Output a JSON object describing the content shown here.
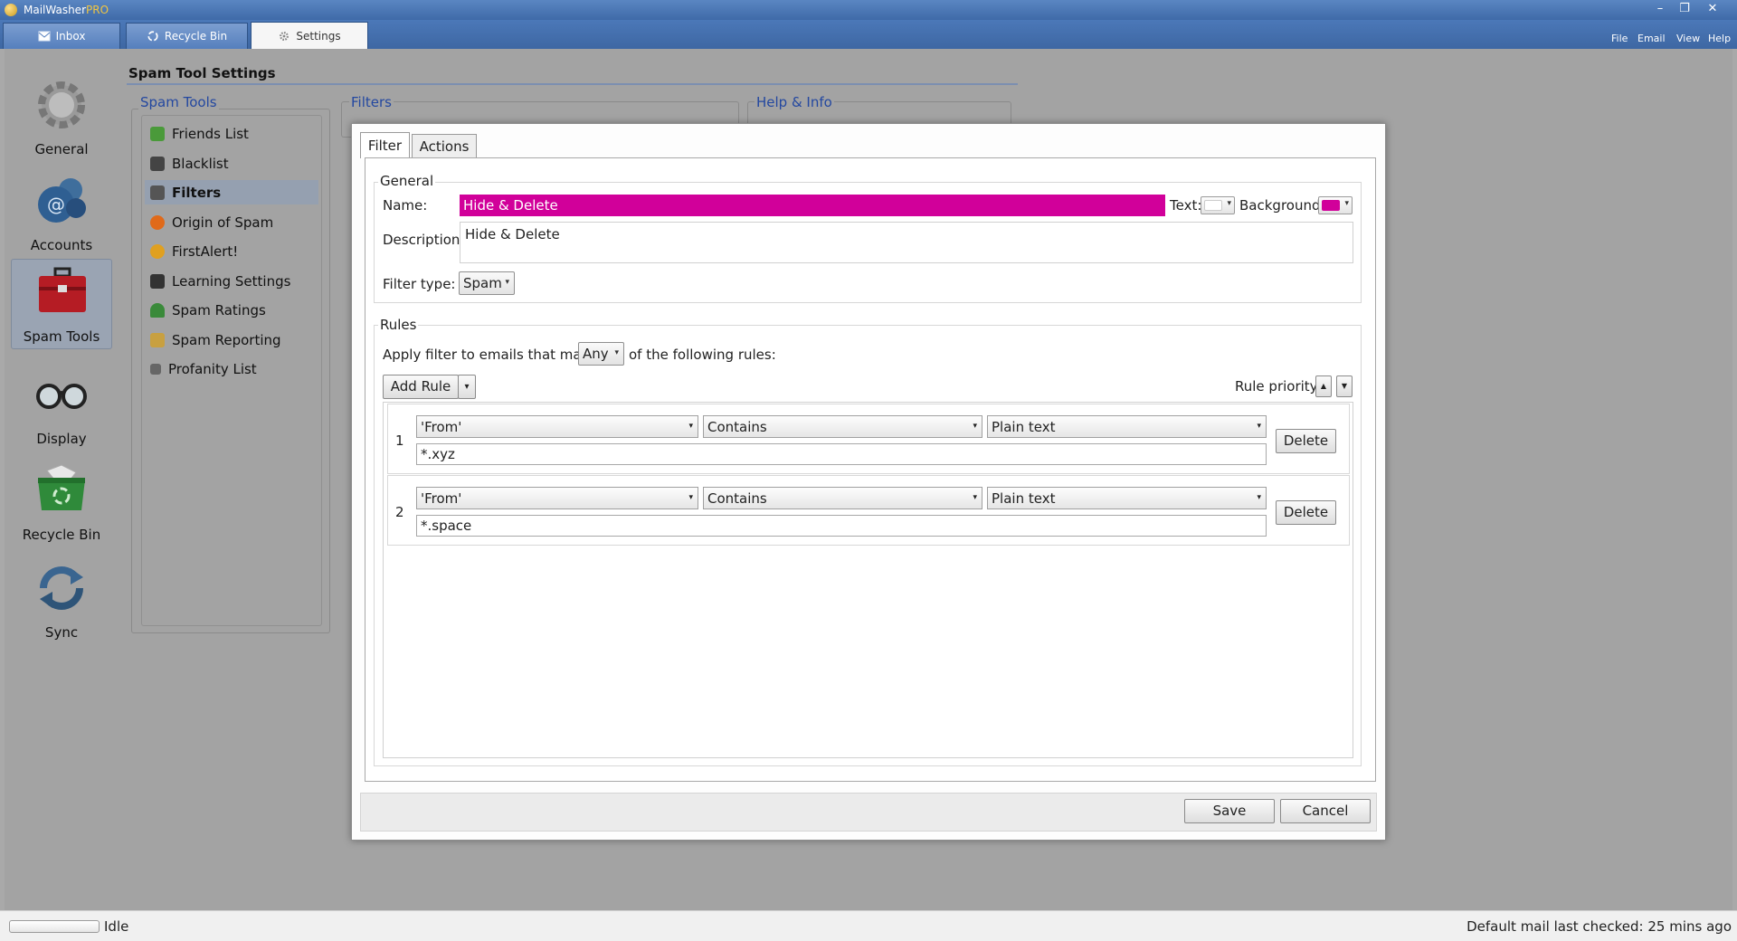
{
  "app": {
    "title_main": "MailWasher",
    "title_suffix": "PRO"
  },
  "window_controls": {
    "minimize": "–",
    "maximize": "❐",
    "close": "✕"
  },
  "tabs": [
    {
      "label": "Inbox"
    },
    {
      "label": "Recycle Bin"
    },
    {
      "label": "Settings"
    }
  ],
  "menu": {
    "file": "File",
    "email": "Email",
    "view": "View",
    "help": "Help"
  },
  "nav": [
    {
      "label": "General",
      "icon": "gear-icon"
    },
    {
      "label": "Accounts",
      "icon": "accounts-icon"
    },
    {
      "label": "Spam Tools",
      "icon": "toolbox-icon"
    },
    {
      "label": "Display",
      "icon": "glasses-icon"
    },
    {
      "label": "Recycle Bin",
      "icon": "recycle-bin-icon"
    },
    {
      "label": "Sync",
      "icon": "sync-icon"
    }
  ],
  "section_title": "Spam Tool Settings",
  "spam_tools": {
    "legend": "Spam Tools",
    "items": [
      {
        "label": "Friends List",
        "color": "#4a9a3a"
      },
      {
        "label": "Blacklist",
        "color": "#444444"
      },
      {
        "label": "Filters",
        "color": "#555555"
      },
      {
        "label": "Origin of Spam",
        "color": "#e06a1a"
      },
      {
        "label": "FirstAlert!",
        "color": "#e0a020"
      },
      {
        "label": "Learning Settings",
        "color": "#333333"
      },
      {
        "label": "Spam Ratings",
        "color": "#3a8a3a"
      },
      {
        "label": "Spam Reporting",
        "color": "#c8a040"
      },
      {
        "label": "Profanity List",
        "color": "#666666"
      }
    ]
  },
  "filters_legend": "Filters",
  "help_legend": "Help & Info",
  "dialog": {
    "tabs": [
      {
        "label": "Filter"
      },
      {
        "label": "Actions"
      }
    ],
    "general_legend": "General",
    "name_label": "Name:",
    "name_value": "Hide & Delete",
    "text_label": "Text:",
    "background_label": "Background:",
    "colors": {
      "text": "#ffffff",
      "background": "#d1009a"
    },
    "description_label": "Description:",
    "description_value": "Hide & Delete",
    "filter_type_label": "Filter type:",
    "filter_type_value": "Spam",
    "rules_legend": "Rules",
    "apply_prefix": "Apply filter to emails that match",
    "match_value": "Any",
    "apply_suffix": "of the following rules:",
    "add_rule_label": "Add Rule",
    "rule_priority_label": "Rule priority:",
    "up_arrow": "▲",
    "down_arrow": "▼",
    "dropdown_arrow": "▾",
    "rules": [
      {
        "num": "1",
        "field": "'From'",
        "op": "Contains",
        "mode": "Plain text",
        "value": "*.xyz",
        "delete_label": "Delete"
      },
      {
        "num": "2",
        "field": "'From'",
        "op": "Contains",
        "mode": "Plain text",
        "value": "*.space",
        "delete_label": "Delete"
      }
    ],
    "save_label": "Save",
    "cancel_label": "Cancel"
  },
  "status": {
    "left": "Idle",
    "right": "Default mail last checked: 25 mins ago"
  }
}
